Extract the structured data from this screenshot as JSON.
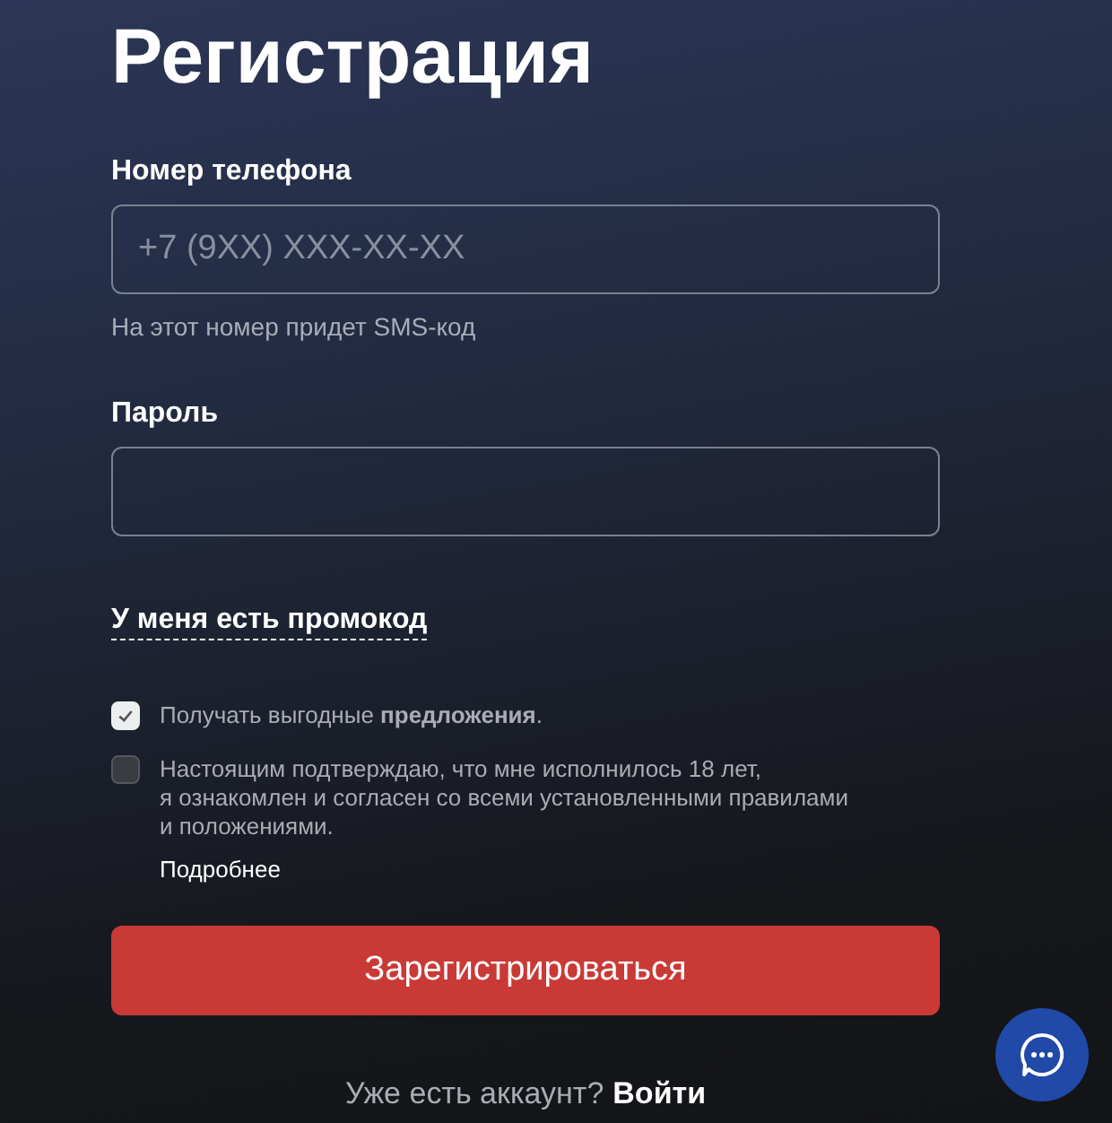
{
  "title": "Регистрация",
  "phone": {
    "label": "Номер телефона",
    "placeholder": "+7 (9XX) XXX-XX-XX",
    "hint": "На этот номер придет SMS-код"
  },
  "password": {
    "label": "Пароль"
  },
  "promo_link": "У меня есть промокод",
  "consents": [
    {
      "text": "Получать выгодные **предложения**.",
      "checked": true
    },
    {
      "text": "Настоящим подтверждаю, что мне исполнилось 18 лет,\nя ознакомлен и согласен со всеми установленными правилами\nи положениями.",
      "checked": false,
      "more": "Подробнее"
    }
  ],
  "submit": "Зарегистрироваться",
  "footer": {
    "text": "Уже есть аккаунт?",
    "link": "Войти"
  }
}
